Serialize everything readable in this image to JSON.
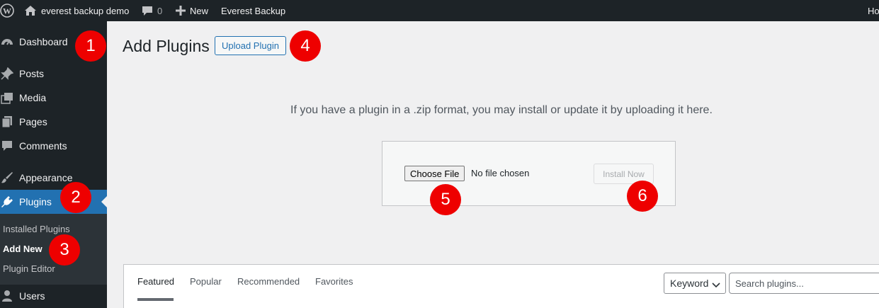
{
  "admin_bar": {
    "site_name": "everest backup demo",
    "comments_count": "0",
    "new_label": "New",
    "plugin_link": "Everest Backup",
    "right_text": "Ho"
  },
  "sidebar": {
    "items": [
      {
        "label": "Dashboard",
        "icon": "dashboard-icon"
      },
      {
        "label": "Posts",
        "icon": "pin-icon"
      },
      {
        "label": "Media",
        "icon": "media-icon"
      },
      {
        "label": "Pages",
        "icon": "pages-icon"
      },
      {
        "label": "Comments",
        "icon": "comment-icon"
      },
      {
        "label": "Appearance",
        "icon": "brush-icon"
      },
      {
        "label": "Plugins",
        "icon": "plug-icon"
      },
      {
        "label": "Users",
        "icon": "user-icon"
      }
    ],
    "submenu": [
      "Installed Plugins",
      "Add New",
      "Plugin Editor"
    ]
  },
  "main": {
    "title": "Add Plugins",
    "upload_button": "Upload Plugin",
    "upload_help": "If you have a plugin in a .zip format, you may install or update it by uploading it here.",
    "choose_file": "Choose File",
    "file_status": "No file chosen",
    "install_button": "Install Now"
  },
  "filters": {
    "tabs": [
      "Featured",
      "Popular",
      "Recommended",
      "Favorites"
    ],
    "keyword_select": "Keyword",
    "search_placeholder": "Search plugins..."
  },
  "markers": [
    "1",
    "2",
    "3",
    "4",
    "5",
    "6"
  ],
  "colors": {
    "admin_dark": "#1d2327",
    "accent_blue": "#2271b1",
    "marker_red": "#ee0000",
    "page_bg": "#f0f0f1"
  }
}
